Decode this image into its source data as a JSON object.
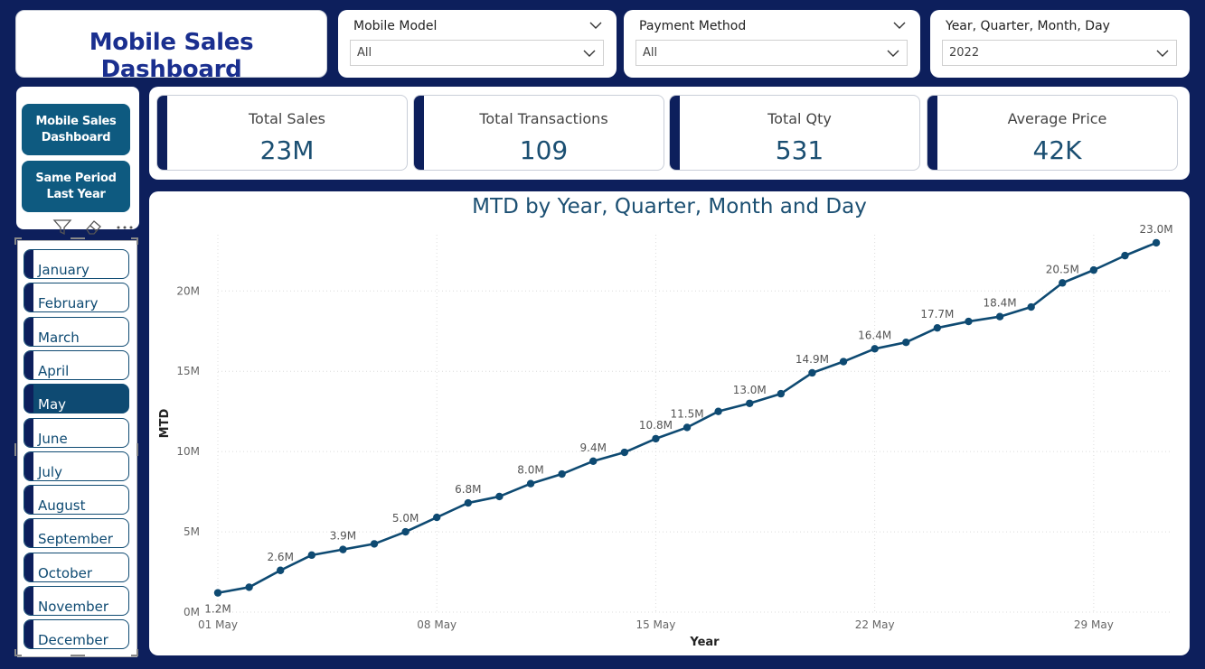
{
  "dashboard": {
    "title": "Mobile Sales Dashboard"
  },
  "slicers": [
    {
      "label": "Mobile Model",
      "value": "All"
    },
    {
      "label": "Payment Method",
      "value": "All"
    },
    {
      "label": "Year, Quarter, Month, Day",
      "value": "2022"
    }
  ],
  "nav": {
    "buttons": [
      {
        "label": "Mobile Sales Dashboard"
      },
      {
        "label": "Same Period Last Year"
      }
    ]
  },
  "months": {
    "items": [
      "January",
      "February",
      "March",
      "April",
      "May",
      "June",
      "July",
      "August",
      "September",
      "October",
      "November",
      "December"
    ],
    "selected": "May"
  },
  "kpis": [
    {
      "label": "Total Sales",
      "value": "23M"
    },
    {
      "label": "Total Transactions",
      "value": "109"
    },
    {
      "label": "Total Qty",
      "value": "531"
    },
    {
      "label": "Average Price",
      "value": "42K"
    }
  ],
  "colors": {
    "navy": "#0d1f5c",
    "teal": "#0e5a80",
    "line": "#0e4a72"
  },
  "chart_data": {
    "type": "line",
    "title": "MTD by Year, Quarter, Month and Day",
    "xlabel": "Year",
    "ylabel": "MTD",
    "x_ticks": [
      "01 May",
      "08 May",
      "15 May",
      "22 May",
      "29 May"
    ],
    "y_ticks": [
      "0M",
      "5M",
      "10M",
      "15M",
      "20M"
    ],
    "ylim": [
      0,
      23.5
    ],
    "grid": true,
    "series": [
      {
        "days": [
          1,
          2,
          3,
          4,
          5,
          6,
          7,
          8,
          9,
          10,
          11,
          12,
          13,
          14,
          15,
          16,
          17,
          18,
          19,
          20,
          21,
          22,
          23,
          24,
          25,
          26,
          27,
          28,
          29,
          30,
          31
        ],
        "values": [
          1.2,
          1.55,
          2.6,
          3.55,
          3.9,
          4.25,
          5.0,
          5.9,
          6.8,
          7.2,
          8.0,
          8.6,
          9.4,
          9.95,
          10.8,
          11.5,
          12.5,
          13.0,
          13.6,
          14.9,
          15.6,
          16.4,
          16.8,
          17.7,
          18.1,
          18.4,
          19.0,
          20.5,
          21.3,
          22.2,
          23.0
        ],
        "labels": [
          "1.2M",
          "",
          "2.6M",
          "",
          "3.9M",
          "",
          "5.0M",
          "",
          "6.8M",
          "",
          "8.0M",
          "",
          "9.4M",
          "",
          "10.8M",
          "11.5M",
          "",
          "13.0M",
          "",
          "14.9M",
          "",
          "16.4M",
          "",
          "17.7M",
          "",
          "18.4M",
          "",
          "20.5M",
          "",
          "",
          "23.0M"
        ]
      }
    ]
  }
}
